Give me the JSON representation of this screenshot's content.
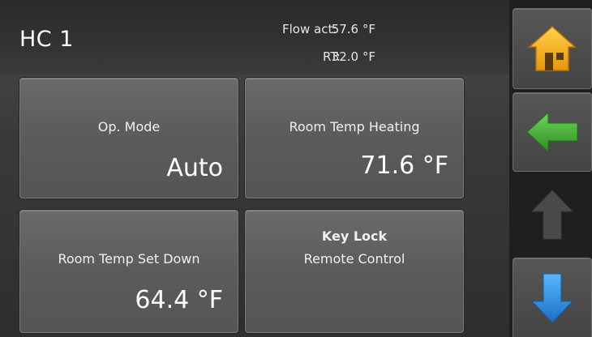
{
  "header": {
    "title": "HC 1",
    "flow": {
      "label": "Flow act:",
      "value": "57.6 °F"
    },
    "rt": {
      "label": "RT:",
      "value": "32.0 °F"
    }
  },
  "tiles": {
    "op_mode": {
      "label": "Op. Mode",
      "value": "Auto"
    },
    "room_temp_heating": {
      "label": "Room Temp Heating",
      "value": "71.6 °F"
    },
    "room_temp_set_down": {
      "label": "Room Temp Set Down",
      "value": "64.4 °F"
    },
    "key_lock": {
      "title": "Key Lock",
      "subtitle": "Remote Control"
    }
  },
  "nav": {
    "home": {
      "icon": "home-icon",
      "color": "#f0a818"
    },
    "back": {
      "icon": "arrow-left-icon",
      "color": "#4caf3c"
    },
    "up": {
      "icon": "arrow-up-icon",
      "color": "#4a4a4a"
    },
    "down": {
      "icon": "arrow-down-icon",
      "color": "#2a8fe0"
    }
  }
}
